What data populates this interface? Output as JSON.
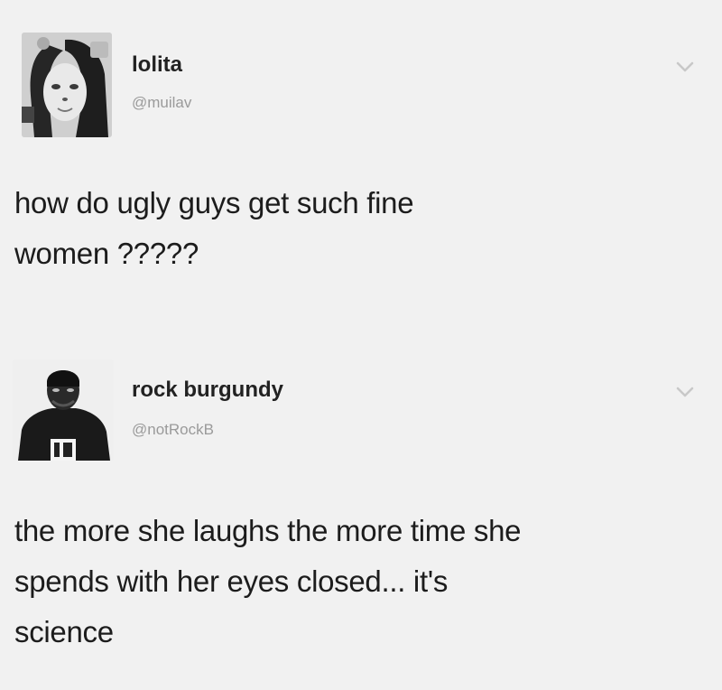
{
  "tweets": [
    {
      "display_name": "lolita",
      "handle": "@muilav",
      "text_lines": [
        "how do ugly guys get such fine",
        "women ?????"
      ],
      "menu_icon": "chevron-down-icon"
    },
    {
      "display_name": "rock burgundy",
      "handle": "@notRockB",
      "text_lines": [
        "the more she laughs the more time she",
        "spends with her eyes closed... it's",
        "science"
      ],
      "menu_icon": "chevron-down-icon"
    }
  ]
}
